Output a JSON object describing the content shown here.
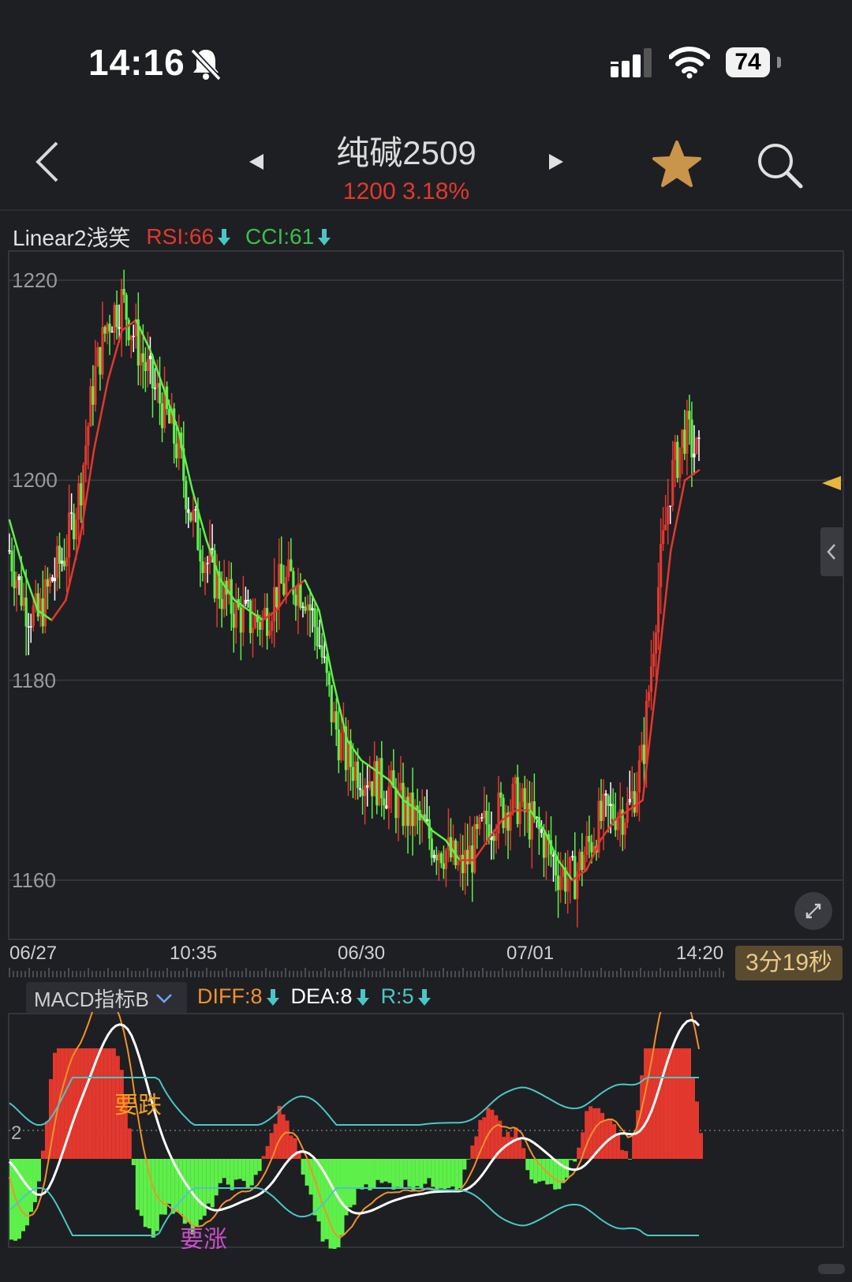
{
  "status": {
    "time": "14:16",
    "battery": "74"
  },
  "nav": {
    "title": "纯碱2509",
    "price": "1200",
    "change": "3.18%"
  },
  "indicator": {
    "name": "Linear2浅笑",
    "rsi": "RSI:66",
    "cci": "CCI:61",
    "colors": {
      "rsi": "#e2382d",
      "cci": "#3cbf4a"
    }
  },
  "axis": {
    "y_ticks": [
      "1220",
      "1200",
      "1180",
      "1160"
    ],
    "x_ticks": [
      "06/27",
      "10:35",
      "06/30",
      "07/01",
      "14:20"
    ]
  },
  "timer": "3分19秒",
  "macd": {
    "selector": "MACD指标B",
    "diff": "DIFF:8",
    "dea": "DEA:8",
    "r": "R:5",
    "level_label": "2",
    "sell_label": "要跌",
    "buy_label": "要涨",
    "colors": {
      "diff": "#f0922b",
      "dea": "#ffffff",
      "r": "#4bc6c6",
      "up": "#e2382d",
      "down": "#5ef04a"
    }
  },
  "chart_data": {
    "type": "line",
    "title": "",
    "ylim": [
      1155,
      1225
    ],
    "y_ticks": [
      1160,
      1180,
      1200,
      1220
    ],
    "x_labels": [
      "06/27",
      "10:35",
      "06/30",
      "07/01",
      "14:20"
    ],
    "series": [
      {
        "values": [
          1193,
          1188,
          1186,
          1190,
          1193,
          1199,
          1210,
          1216,
          1218,
          1214,
          1210,
          1207,
          1203,
          1196,
          1192,
          1189,
          1187,
          1186,
          1186,
          1189,
          1190,
          1189,
          1184,
          1176,
          1172,
          1171,
          1170,
          1169,
          1167,
          1166,
          1164,
          1163,
          1161,
          1163,
          1166,
          1167,
          1168,
          1166,
          1164,
          1161,
          1160,
          1163,
          1166,
          1167,
          1167,
          1172,
          1188,
          1200,
          1205,
          1202
        ]
      },
      {
        "values": [
          1196,
          1191,
          1187,
          1186,
          1188,
          1194,
          1203,
          1210,
          1215,
          1216,
          1213,
          1209,
          1205,
          1199,
          1194,
          1190,
          1188,
          1187,
          1186,
          1187,
          1189,
          1190,
          1187,
          1180,
          1174,
          1172,
          1171,
          1170,
          1168,
          1167,
          1165,
          1164,
          1162,
          1162,
          1164,
          1166,
          1167,
          1167,
          1165,
          1162,
          1160,
          1161,
          1164,
          1166,
          1167,
          1168,
          1180,
          1193,
          1200,
          1201
        ]
      }
    ]
  }
}
